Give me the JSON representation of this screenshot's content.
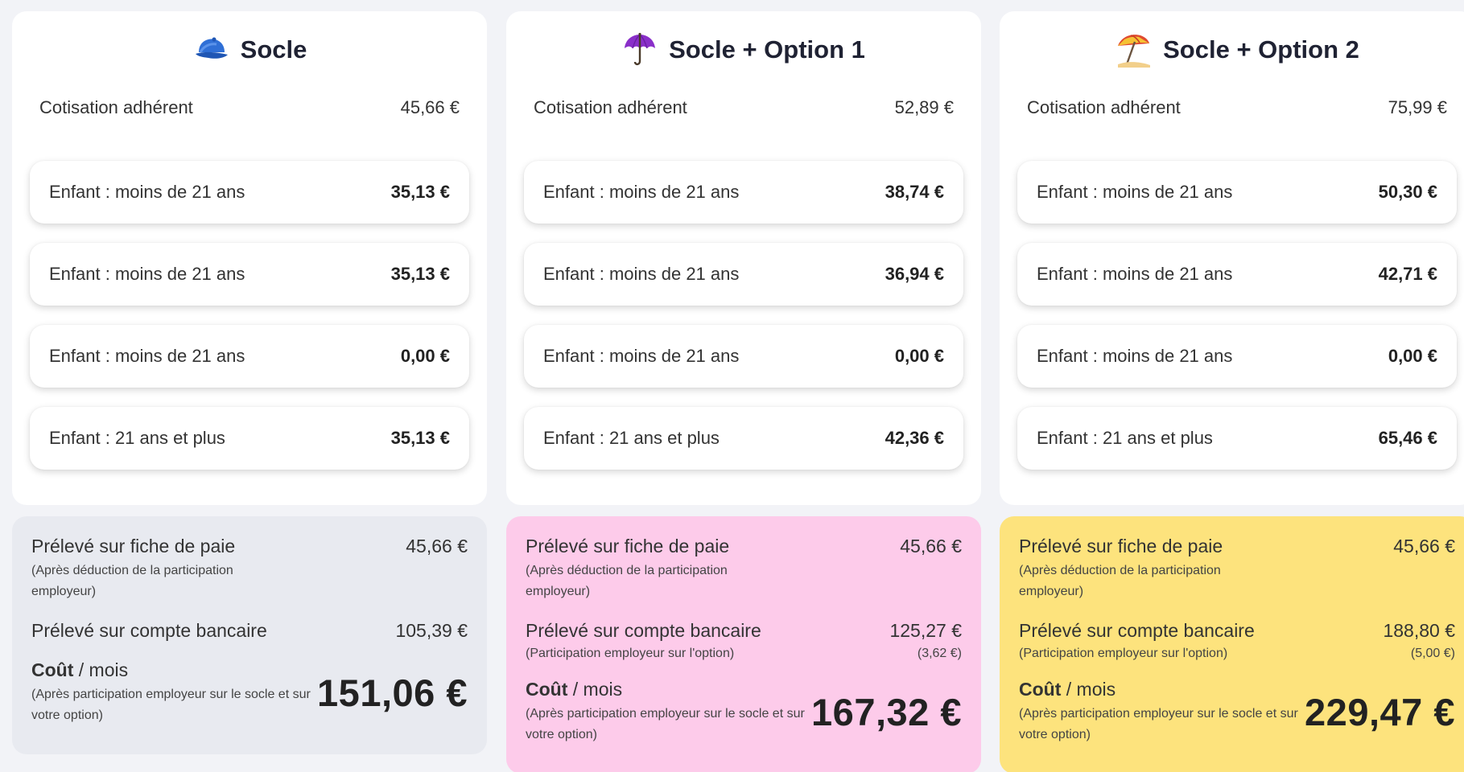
{
  "plans": [
    {
      "title": "Socle",
      "icon": "cap-icon",
      "member_label": "Cotisation adhérent",
      "member_value": "45,66 €",
      "children": [
        {
          "label": "Enfant : moins de 21 ans",
          "value": "35,13 €"
        },
        {
          "label": "Enfant : moins de 21 ans",
          "value": "35,13 €"
        },
        {
          "label": "Enfant : moins de 21 ans",
          "value": "0,00 €"
        },
        {
          "label": "Enfant : 21 ans et plus",
          "value": "35,13 €"
        }
      ],
      "summary_color": "#e8eaf0",
      "payslip_label": "Prélevé sur fiche de paie",
      "payslip_value": "45,66 €",
      "payslip_note": "(Après déduction de la participation employeur)",
      "bank_label": "Prélevé sur compte bancaire",
      "bank_value": "105,39 €",
      "bank_note": "",
      "bank_note_value": "",
      "cost_title_bold": "Coût",
      "cost_title_rest": " / mois",
      "cost_note": "(Après participation employeur sur le socle et sur votre option)",
      "cost_value": "151,06 €"
    },
    {
      "title": "Socle + Option 1",
      "icon": "umbrella-icon",
      "member_label": "Cotisation adhérent",
      "member_value": "52,89 €",
      "children": [
        {
          "label": "Enfant : moins de 21 ans",
          "value": "38,74 €"
        },
        {
          "label": "Enfant : moins de 21 ans",
          "value": "36,94 €"
        },
        {
          "label": "Enfant : moins de 21 ans",
          "value": "0,00 €"
        },
        {
          "label": "Enfant : 21 ans et plus",
          "value": "42,36 €"
        }
      ],
      "summary_color": "#fdcbea",
      "payslip_label": "Prélevé sur fiche de paie",
      "payslip_value": "45,66 €",
      "payslip_note": "(Après déduction de la participation employeur)",
      "bank_label": "Prélevé sur compte bancaire",
      "bank_value": "125,27 €",
      "bank_note": "(Participation employeur sur l'option)",
      "bank_note_value": "(3,62 €)",
      "cost_title_bold": "Coût",
      "cost_title_rest": " / mois",
      "cost_note": "(Après participation employeur sur le socle et sur votre option)",
      "cost_value": "167,32 €"
    },
    {
      "title": "Socle + Option 2",
      "icon": "beach-umbrella-icon",
      "member_label": "Cotisation adhérent",
      "member_value": "75,99 €",
      "children": [
        {
          "label": "Enfant : moins de 21 ans",
          "value": "50,30 €"
        },
        {
          "label": "Enfant : moins de 21 ans",
          "value": "42,71 €"
        },
        {
          "label": "Enfant : moins de 21 ans",
          "value": "0,00 €"
        },
        {
          "label": "Enfant : 21 ans et plus",
          "value": "65,46 €"
        }
      ],
      "summary_color": "#fde37d",
      "payslip_label": "Prélevé sur fiche de paie",
      "payslip_value": "45,66 €",
      "payslip_note": "(Après déduction de la participation employeur)",
      "bank_label": "Prélevé sur compte bancaire",
      "bank_value": "188,80 €",
      "bank_note": "(Participation employeur sur l'option)",
      "bank_note_value": "(5,00 €)",
      "cost_title_bold": "Coût",
      "cost_title_rest": " / mois",
      "cost_note": "(Après participation employeur sur le socle et sur votre option)",
      "cost_value": "229,47 €"
    }
  ]
}
